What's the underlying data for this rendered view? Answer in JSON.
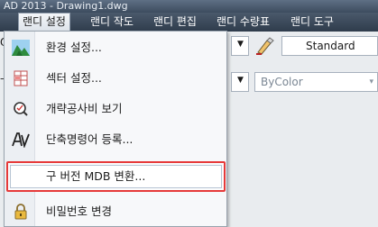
{
  "window": {
    "title": "AD 2013 - Drawing1.dwg"
  },
  "menubar": {
    "items": [
      {
        "label": "랜디 설정"
      },
      {
        "label": "랜디 작도"
      },
      {
        "label": "랜디 편집"
      },
      {
        "label": "랜디 수량표"
      },
      {
        "label": "랜디 도구"
      }
    ]
  },
  "toolbar": {
    "left_stub_1": "O-",
    "left_stub_2": "—",
    "style_value": "Standard",
    "color_value": "ByColor"
  },
  "dropdown_menu": {
    "items": [
      {
        "label": "환경 설정...",
        "icon": "landscape-icon"
      },
      {
        "label": "섹터 설정...",
        "icon": "sector-grid-icon"
      },
      {
        "label": "개략공사비 보기",
        "icon": "cost-magnifier-icon"
      },
      {
        "label": "단축명령어 등록...",
        "icon": "shortcut-av-icon"
      },
      {
        "label": "구 버전 MDB 변환...",
        "icon": "none",
        "highlighted": true
      },
      {
        "label": "비밀번호 변경",
        "icon": "lock-icon"
      }
    ]
  },
  "colors": {
    "menubar": "#3d4c5f",
    "highlight_border": "#e63a3a"
  }
}
